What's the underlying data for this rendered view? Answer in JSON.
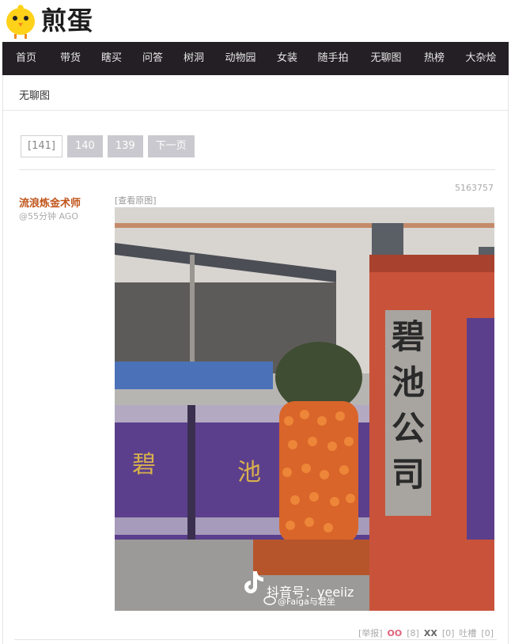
{
  "logo": {
    "text": "煎蛋"
  },
  "nav": {
    "items": [
      "首页",
      "带货",
      "瞎买",
      "问答",
      "树洞",
      "动物园",
      "女装",
      "随手拍",
      "无聊图",
      "热榜",
      "大杂烩"
    ]
  },
  "section": {
    "title": "无聊图"
  },
  "pager": {
    "current": "[141]",
    "pages": [
      "140",
      "139"
    ],
    "next": "下一页"
  },
  "post": {
    "author": "流浪炼金术师",
    "time": "@55分钟 AGO",
    "id": "5163757",
    "orig_link": "[查看原图]",
    "image": {
      "sign_text": [
        "碧",
        "池",
        "公",
        "司"
      ],
      "gate_left_text": "碧",
      "gate_right_text": "池",
      "watermark_main": "抖音号：yeeiiz",
      "watermark_sub": "@Faiga与君坐"
    },
    "actions": {
      "report": "[举报]",
      "oo_label": "OO",
      "oo_count": "[8]",
      "xx_label": "XX",
      "xx_count": "[0]",
      "comment_label": "吐槽",
      "comment_count": "[0]"
    }
  },
  "colors": {
    "nav_bg": "#231f24",
    "author": "#c0541a",
    "pager_button": "#c9c9cf",
    "oo": "#e0607a"
  }
}
